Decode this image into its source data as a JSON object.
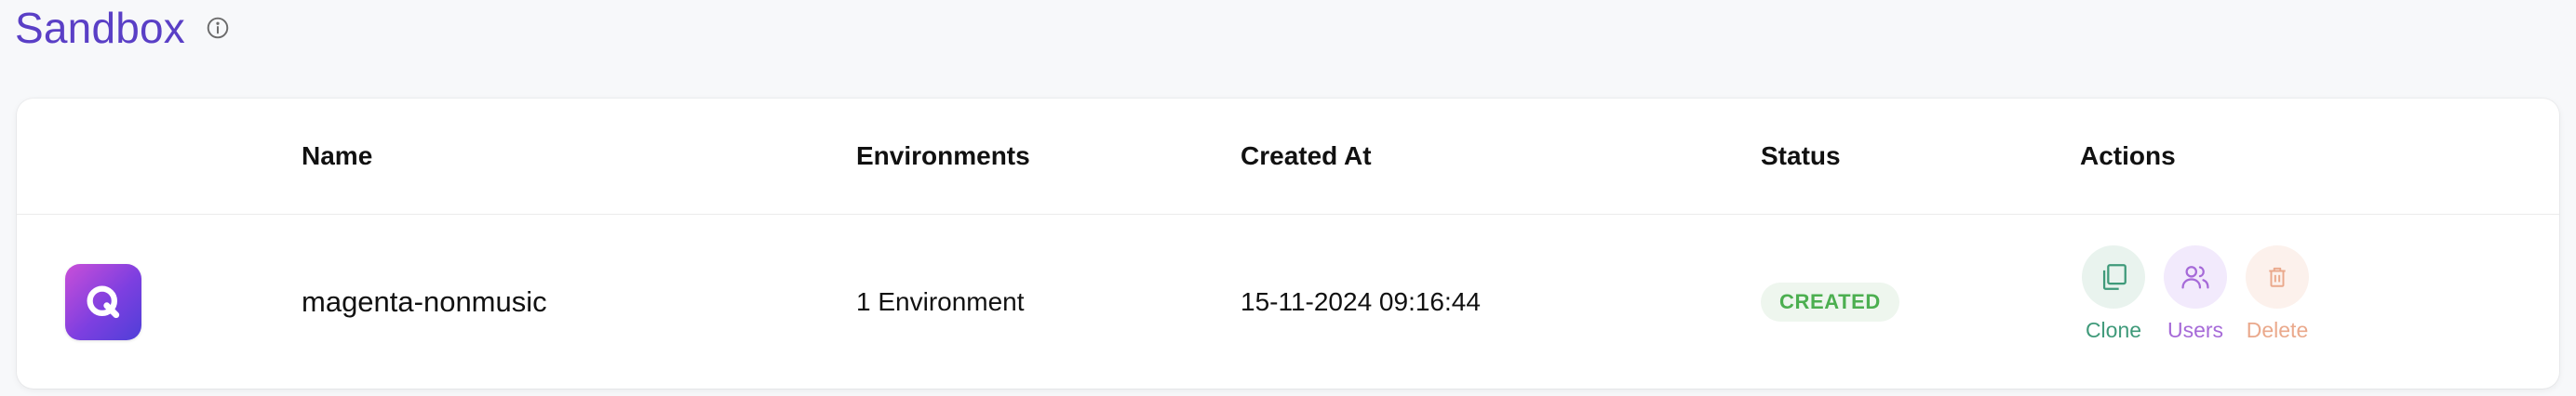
{
  "page": {
    "title": "Sandbox",
    "info_icon": "info-circle-icon"
  },
  "table": {
    "columns": [
      "Name",
      "Environments",
      "Created At",
      "Status",
      "Actions"
    ],
    "rows": [
      {
        "logo_icon": "app-q-logo-icon",
        "name": "magenta-nonmusic",
        "environments": "1 Environment",
        "created_at": "15-11-2024 09:16:44",
        "status": "CREATED",
        "actions": [
          {
            "label": "Clone",
            "icon": "copy-icon",
            "color": "#3f9a7a"
          },
          {
            "label": "Users",
            "icon": "users-icon",
            "color": "#a66ad8"
          },
          {
            "label": "Delete",
            "icon": "trash-icon",
            "color": "#eaa98c"
          }
        ]
      }
    ]
  },
  "colors": {
    "title": "#5a3fc6",
    "status_created": "#4caf50",
    "logo_gradient_start": "#c94fd8",
    "logo_gradient_end": "#4f3fd8"
  }
}
